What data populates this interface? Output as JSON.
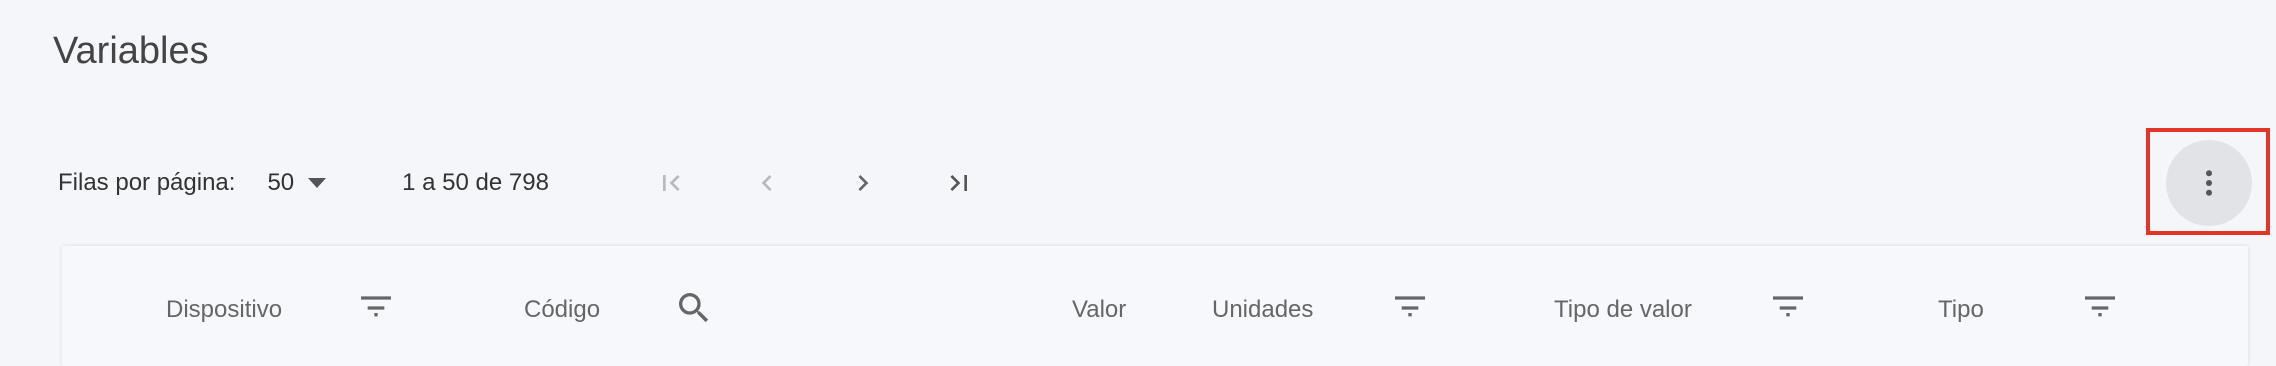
{
  "page": {
    "title": "Variables"
  },
  "paginator": {
    "rows_per_page_label": "Filas por página:",
    "rows_per_page_value": "50",
    "range_label": "1 a 50 de 798"
  },
  "table": {
    "headers": [
      {
        "label": "Dispositivo",
        "icon": "filter-icon"
      },
      {
        "label": "Código",
        "icon": "search-icon"
      },
      {
        "label": "Valor",
        "icon": ""
      },
      {
        "label": "Unidades",
        "icon": "filter-icon"
      },
      {
        "label": "Tipo de valor",
        "icon": "filter-icon"
      },
      {
        "label": "Tipo",
        "icon": "filter-icon"
      }
    ]
  },
  "colors": {
    "background": "#f5f6fa",
    "highlight": "#e3342a",
    "more_button_bg": "#e2e3e7"
  }
}
